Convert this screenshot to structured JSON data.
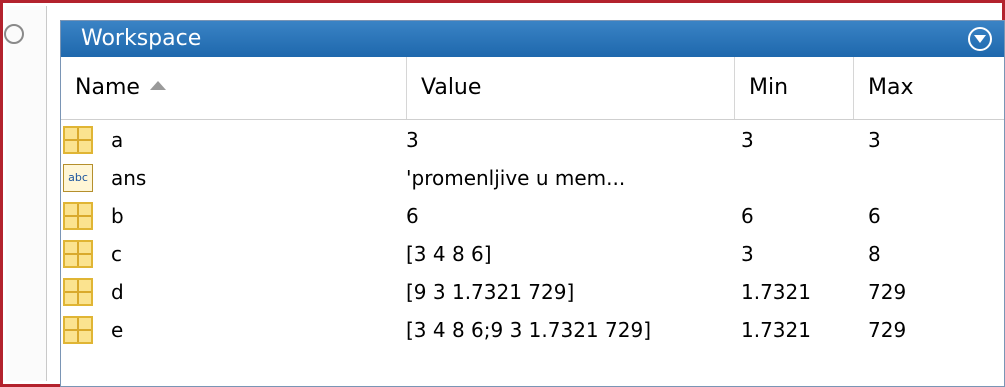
{
  "workspace": {
    "title": "Workspace",
    "menu_icon": "chevron-down-circle-icon"
  },
  "columns": {
    "name": "Name",
    "value": "Value",
    "min": "Min",
    "max": "Max"
  },
  "variables": [
    {
      "icon": "matrix-icon",
      "name": "a",
      "value": "3",
      "min": "3",
      "max": "3"
    },
    {
      "icon": "char-icon",
      "icon_text": "abc",
      "name": "ans",
      "value": "'promenljive u mem...",
      "min": "",
      "max": ""
    },
    {
      "icon": "matrix-icon",
      "name": "b",
      "value": "6",
      "min": "6",
      "max": "6"
    },
    {
      "icon": "matrix-icon",
      "name": "c",
      "value": "[3 4 8 6]",
      "min": "3",
      "max": "8"
    },
    {
      "icon": "matrix-icon",
      "name": "d",
      "value": "[9 3 1.7321 729]",
      "min": "1.7321",
      "max": "729"
    },
    {
      "icon": "matrix-icon",
      "name": "e",
      "value": "[3 4 8 6;9 3 1.7321 729]",
      "min": "1.7321",
      "max": "729"
    }
  ],
  "colors": {
    "titlebar": "#2a76bb",
    "frame": "#b3222d",
    "matrix_icon_fill": "#fbe38f"
  }
}
